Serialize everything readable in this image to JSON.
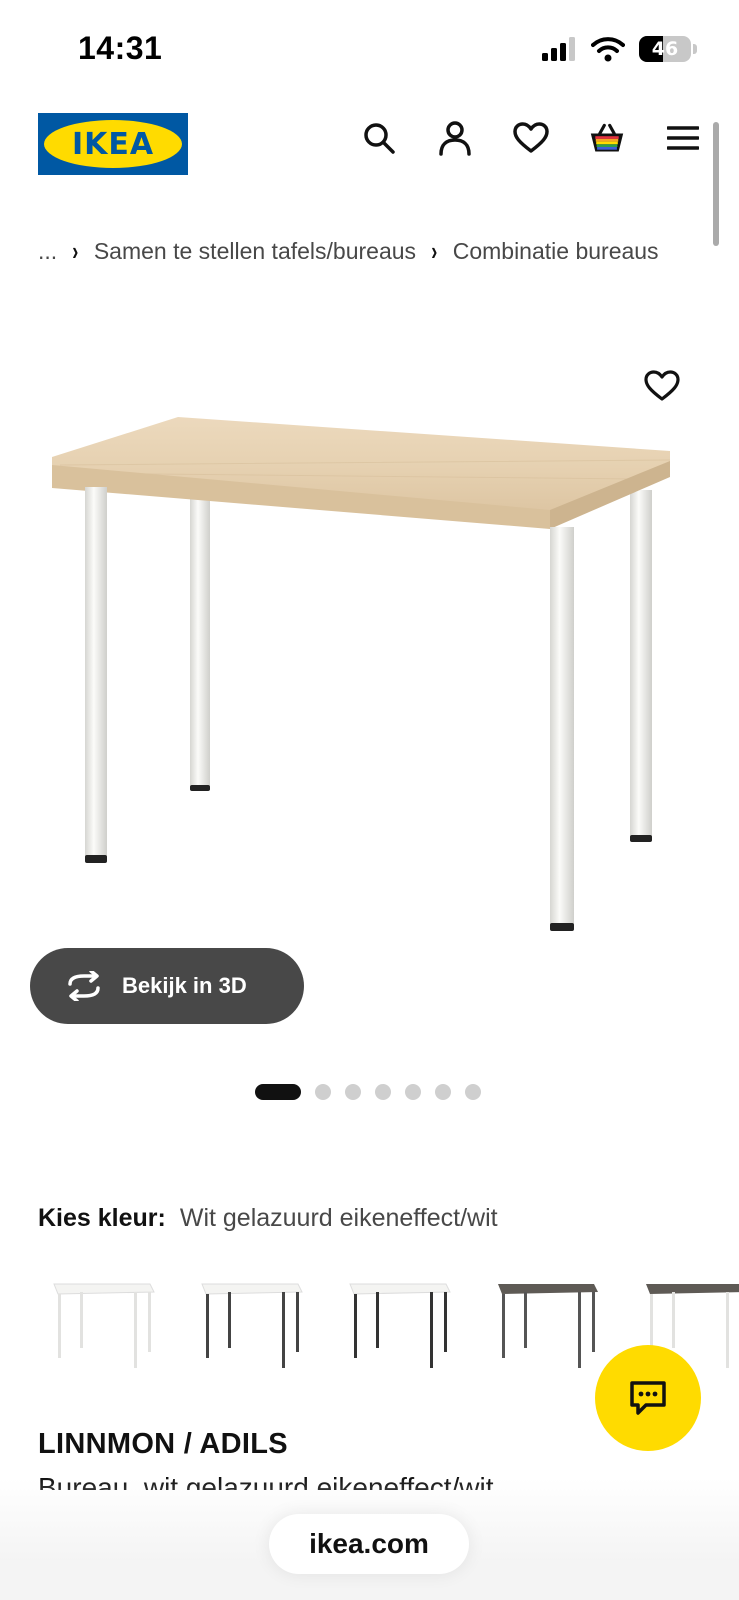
{
  "status_bar": {
    "time": "14:31",
    "battery": "46",
    "battery_level": 0.46
  },
  "header": {
    "logo_text": "IKEA",
    "actions": [
      "search-icon",
      "account-icon",
      "heart-icon",
      "basket-icon",
      "menu-icon"
    ]
  },
  "breadcrumb": {
    "ellipsis": "...",
    "items": [
      "Samen te stellen tafels/bureaus",
      "Combinatie bureaus"
    ]
  },
  "gallery": {
    "view_3d_label": "Bekijk in 3D",
    "dot_count": 7,
    "active_index": 0
  },
  "color_picker": {
    "heading": "Kies kleur:",
    "selected": "Wit gelazuurd eikeneffect/wit",
    "swatches": [
      "white-white",
      "white-dark",
      "white-dark-2",
      "dark-dark",
      "dark-white"
    ]
  },
  "product": {
    "name": "LINNMON / ADILS",
    "description": "Bureau, wit gelazuurd eikeneffect/wit"
  },
  "browser": {
    "url": "ikea.com"
  },
  "colors": {
    "ikea_blue": "#0058a3",
    "ikea_yellow": "#ffdb00",
    "button_dark": "#484848"
  }
}
